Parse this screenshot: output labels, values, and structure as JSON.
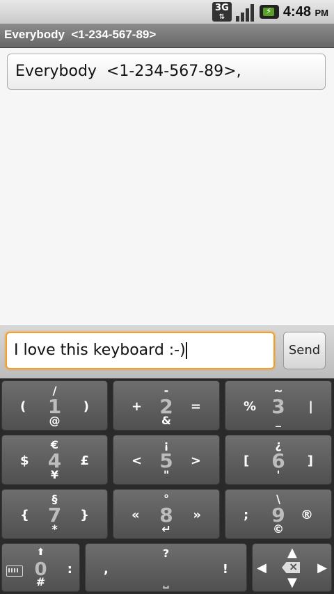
{
  "status_bar": {
    "network": "3G",
    "time": "4:48",
    "ampm": "PM"
  },
  "title": "Everybody  <1-234-567-89>",
  "recipients": "Everybody  <1-234-567-89>,",
  "compose": {
    "message": "I love this keyboard :-)",
    "send_label": "Send"
  },
  "keyboard": {
    "keys": [
      {
        "main": "1",
        "top": "/",
        "bottom": "@",
        "left": "(",
        "right": ")"
      },
      {
        "main": "2",
        "top": "-",
        "bottom": "&",
        "left": "+",
        "right": "="
      },
      {
        "main": "3",
        "top": "~",
        "bottom": "_",
        "left": "%",
        "right": "|"
      },
      {
        "main": "4",
        "top": "€",
        "bottom": "¥",
        "left": "$",
        "right": "£"
      },
      {
        "main": "5",
        "top": "¡",
        "bottom": "\"",
        "left": "<",
        "right": ">"
      },
      {
        "main": "6",
        "top": "¿",
        "bottom": "'",
        "left": "[",
        "right": "]"
      },
      {
        "main": "7",
        "top": "§",
        "bottom": "*",
        "left": "{",
        "right": "}"
      },
      {
        "main": "8",
        "top": "°",
        "bottom": "↵",
        "left": "«",
        "right": "»"
      },
      {
        "main": "9",
        "top": "\\",
        "bottom": "©",
        "left": ";",
        "right": "®"
      }
    ],
    "zero": {
      "main": "0",
      "bottom": "#",
      "right": ":"
    },
    "space": {
      "top": "?",
      "left": ",",
      "right": "!",
      "bottom": "⎵"
    }
  }
}
